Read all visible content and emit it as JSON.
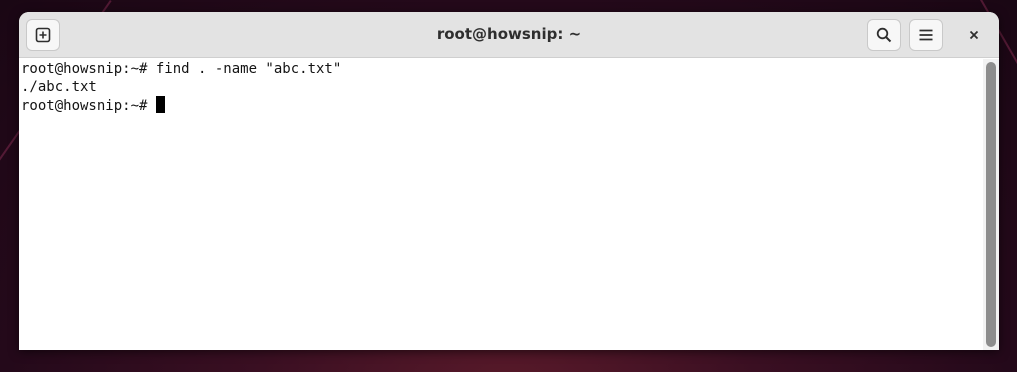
{
  "window": {
    "title": "root@howsnip: ~"
  },
  "titlebar": {
    "new_tab_icon": "new-tab-icon",
    "search_icon": "search-icon",
    "menu_icon": "hamburger-menu-icon",
    "close_icon": "close-icon"
  },
  "terminal": {
    "lines": [
      "root@howsnip:~# find . -name \"abc.txt\"",
      "./abc.txt",
      "root@howsnip:~# "
    ]
  },
  "colors": {
    "titlebar_bg": "#e3e3e3",
    "terminal_bg": "#ffffff",
    "terminal_fg": "#141414",
    "desktop_bg": "#2a0a1c"
  }
}
